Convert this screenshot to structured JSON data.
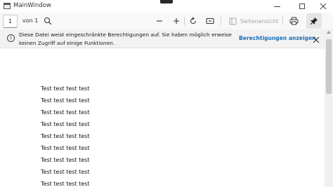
{
  "window": {
    "title": "MainWindow",
    "minimize_icon": "minimize-icon",
    "maximize_icon": "maximize-icon",
    "close_icon": "close-icon"
  },
  "toolbar": {
    "page_number": "1",
    "page_of": "von 1",
    "icons": [
      "search-icon",
      "zoom-out-icon",
      "zoom-in-icon",
      "rotate-icon",
      "fit-page-icon",
      "side-view-icon",
      "print-icon",
      "pin-icon"
    ],
    "side_view_label": "Seitenansicht"
  },
  "infobar": {
    "message": "Diese Datei weist eingeschränkte Berechtigungen auf. Sie haben möglich erweise keinen Zugriff auf einige Funktionen.",
    "message_line1": "Diese Datei weist eingeschränkte Berechtigungen auf. Sie haben möglich erweise",
    "message_line2": "keinen Zugriff auf einige Funktionen.",
    "link_label": "Berechtigungen anzeigen",
    "info_icon_glyph": "i"
  },
  "document": {
    "lines": [
      "Test test test test",
      "Test test test test",
      "Test test test test",
      "Test test test test",
      "Test test test test",
      "Test test test test",
      "Test test test test",
      "Test test test test",
      "Test test test test"
    ]
  },
  "colors": {
    "link": "#1a6fb5",
    "infobar_bg": "#f2f2f2",
    "toolbar_bg": "#f8f8f8"
  }
}
